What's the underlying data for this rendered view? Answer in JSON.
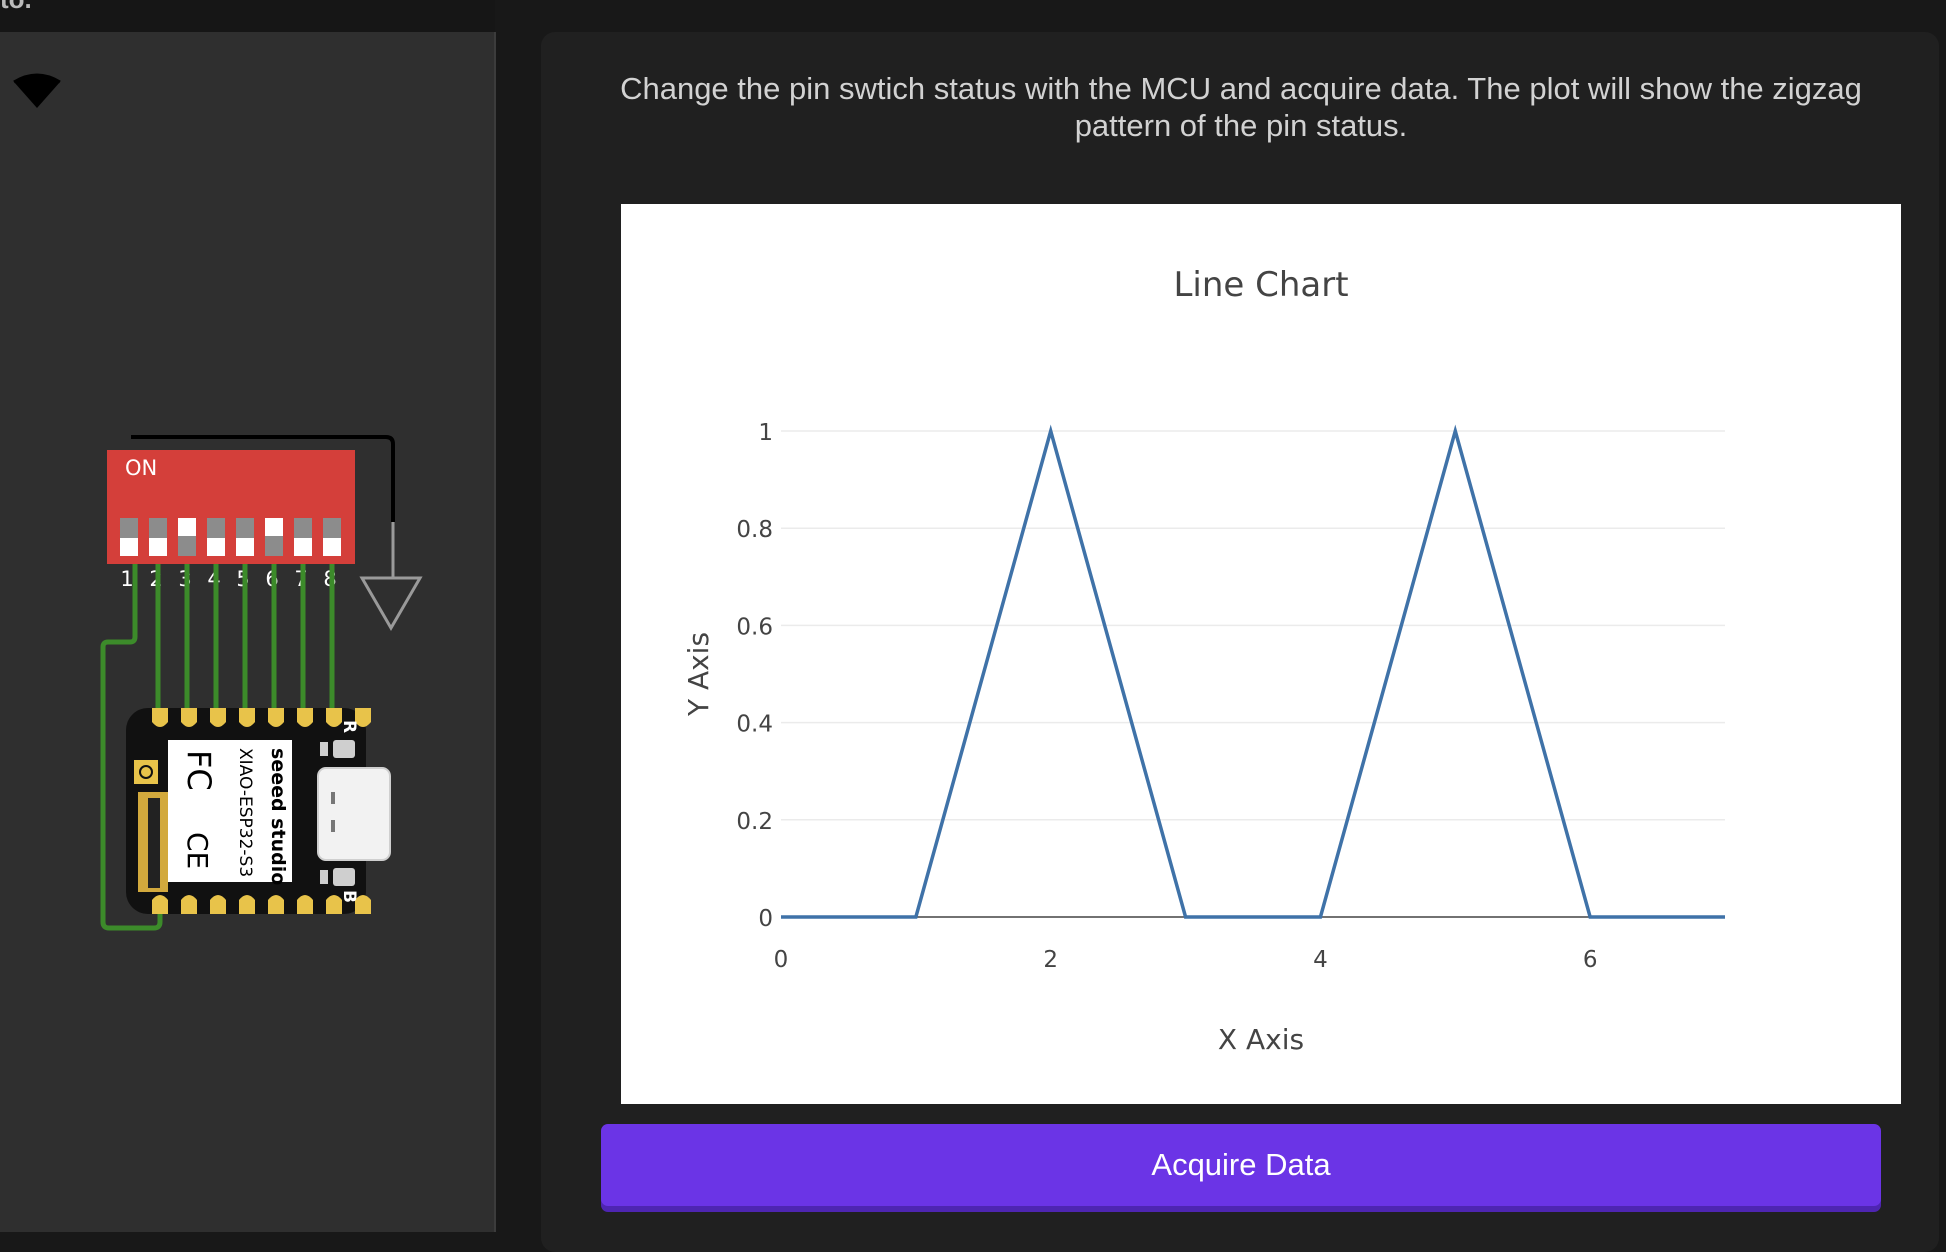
{
  "window": {
    "title_fragment": "to."
  },
  "circuit": {
    "dip_switch": {
      "on_label": "ON",
      "numbers": [
        "1",
        "2",
        "3",
        "4",
        "5",
        "6",
        "7",
        "8"
      ],
      "states": [
        0,
        0,
        1,
        0,
        0,
        1,
        0,
        0
      ],
      "color": "#d43f3a"
    },
    "board": {
      "brand": "seeed studio",
      "model": "XIAO-ESP32-S3",
      "fcc_mark": "FC",
      "ce_mark": "CE",
      "reset_label": "R",
      "boot_label": "B"
    },
    "wire_color": "#3c8b2a",
    "icons": [
      "wifi-icon",
      "ground-symbol-icon"
    ]
  },
  "description": "Change the pin swtich status with the MCU and acquire data. The plot will show the zigzag pattern of the pin status.",
  "chart_data": {
    "type": "line",
    "title": "Line Chart",
    "xlabel": "X Axis",
    "ylabel": "Y Axis",
    "x": [
      0,
      1,
      2,
      3,
      4,
      5,
      6,
      7
    ],
    "series": [
      {
        "values": [
          0,
          0,
          1,
          0,
          0,
          1,
          0,
          0
        ],
        "color": "#3f72a8"
      }
    ],
    "xlim": [
      0,
      7
    ],
    "ylim": [
      0,
      1
    ],
    "xticks": [
      0,
      2,
      4,
      6
    ],
    "xtick_labels": [
      "0",
      "2",
      "4",
      "6"
    ],
    "yticks": [
      0,
      0.2,
      0.4,
      0.6,
      0.8,
      1
    ],
    "ytick_labels": [
      "0",
      "0.2",
      "0.4",
      "0.6",
      "0.8",
      "1"
    ],
    "grid": true,
    "legend": "none"
  },
  "button": {
    "label": "Acquire Data",
    "color": "#6b34e6"
  }
}
